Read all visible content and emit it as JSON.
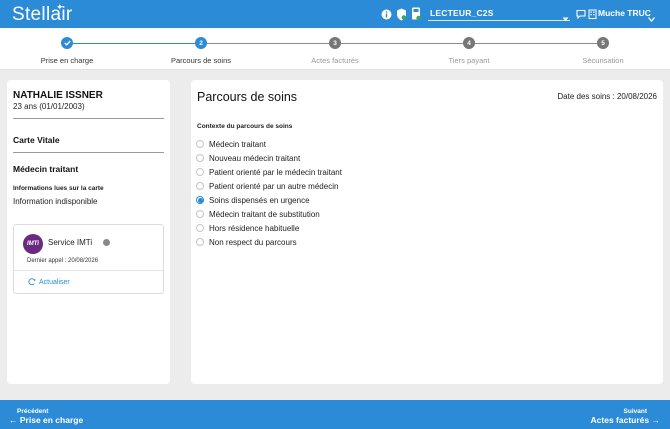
{
  "header": {
    "logo": "Stellair",
    "reader": "LECTEUR_C2S",
    "user": "Muche TRUC"
  },
  "stepper": {
    "steps": [
      {
        "number": "1",
        "label": "Prise en charge",
        "state": "done"
      },
      {
        "number": "2",
        "label": "Parcours de soins",
        "state": "active"
      },
      {
        "number": "3",
        "label": "Actes facturés",
        "state": "pending"
      },
      {
        "number": "4",
        "label": "Tiers payant",
        "state": "pending"
      },
      {
        "number": "5",
        "label": "Sécurisation",
        "state": "pending"
      }
    ],
    "colors": {
      "active": "#2c8bd6",
      "pending": "#777777",
      "pending_label": "#999999"
    }
  },
  "patient": {
    "name": "NATHALIE ISSNER",
    "age": "23 ans (01/01/2003)",
    "carte_vitale": "Carte Vitale",
    "medecin_traitant": "Médecin traitant",
    "info_label": "Informations lues sur la carte",
    "info_value": "Information indisponible",
    "service": {
      "logo_text": "IMTi",
      "name": "Service IMTi",
      "last_call": "Dernier appel : 20/08/2026",
      "refresh_label": "Actualiser"
    }
  },
  "main": {
    "title": "Parcours de soins",
    "date": "Date des soins : 20/08/2026",
    "context_label": "Contexte du parcours de soins",
    "options": [
      {
        "label": "Médecin traitant",
        "checked": false
      },
      {
        "label": "Nouveau médecin traitant",
        "checked": false
      },
      {
        "label": "Patient orienté par le médecin traitant",
        "checked": false
      },
      {
        "label": "Patient orienté par un autre médecin",
        "checked": false
      },
      {
        "label": "Soins dispensés en urgence",
        "checked": true
      },
      {
        "label": "Médecin traitant de substitution",
        "checked": false
      },
      {
        "label": "Hors résidence habituelle",
        "checked": false
      },
      {
        "label": "Non respect du parcours",
        "checked": false
      }
    ]
  },
  "footer": {
    "prev_small": "Précédent",
    "prev_big": "Prise en charge",
    "next_small": "Suivant",
    "next_big": "Actes facturés"
  }
}
